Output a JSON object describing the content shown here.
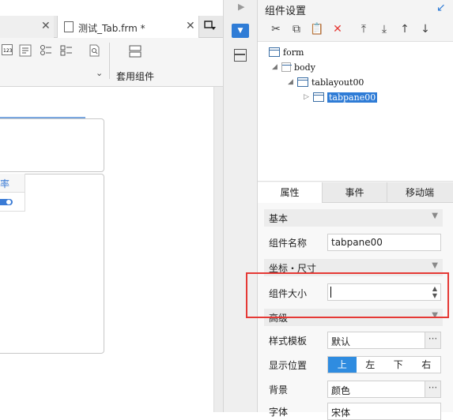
{
  "editor": {
    "tabs": [
      {
        "label": "",
        "close": "✕"
      },
      {
        "label": "测试_Tab.frm *",
        "close": "✕"
      }
    ],
    "overflow_icon": "window-menu-icon",
    "toolbar": {
      "apply_component_label": "套用组件",
      "more_chevron": "⌄"
    },
    "canvas": {
      "tab_header_text": "率"
    }
  },
  "sidebar_strip": {
    "expand_arrow": "▶",
    "active_icon": "▼"
  },
  "panel": {
    "title": "组件设置",
    "pin_icon": "↙",
    "tree_toolbar": {
      "cut": "✂",
      "copy": "⧉",
      "paste": "📋",
      "delete": "✕",
      "move_top": "⤒",
      "move_bottom": "⤓",
      "move_up": "↑",
      "move_down": "↓"
    },
    "tree": [
      {
        "label": "form",
        "level": 0,
        "expander": ""
      },
      {
        "label": "body",
        "level": 1,
        "expander": "◢"
      },
      {
        "label": "tablayout00",
        "level": 2,
        "expander": "◢"
      },
      {
        "label": "tabpane00",
        "level": 3,
        "expander": "▷",
        "selected": true
      }
    ],
    "tabs": [
      "属性",
      "事件",
      "移动端"
    ],
    "active_tab": "属性",
    "sections": {
      "basic": "基本",
      "coords": "坐标・尺寸",
      "advanced": "高级"
    },
    "props": {
      "name_label": "组件名称",
      "name_value": "tabpane00",
      "size_label": "组件大小",
      "size_value": "",
      "template_label": "样式模板",
      "template_value": "默认",
      "position_label": "显示位置",
      "position_options": [
        "上",
        "左",
        "下",
        "右"
      ],
      "position_selected": "上",
      "background_label": "背景",
      "background_value": "颜色",
      "font_label": "字体",
      "font_value": "宋体",
      "more": "···"
    }
  },
  "colors": {
    "accent": "#2f7cd6",
    "highlight": "#e53935"
  }
}
